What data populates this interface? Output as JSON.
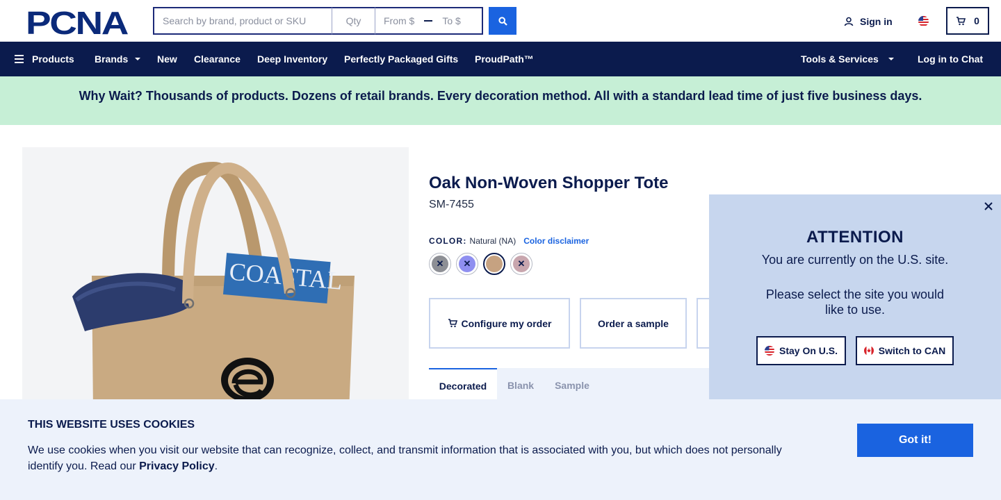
{
  "header": {
    "logo_text": "PCNA",
    "search": {
      "placeholder": "Search by brand, product or SKU"
    },
    "qty": {
      "placeholder": "Qty"
    },
    "price": {
      "from_placeholder": "From $",
      "to_placeholder": "To $"
    },
    "sign_in_label": "Sign in",
    "cart_count": "0"
  },
  "nav": {
    "items": [
      "Products",
      "Brands",
      "New",
      "Clearance",
      "Deep Inventory",
      "Perfectly Packaged Gifts",
      "ProudPath™"
    ],
    "tools_label": "Tools & Services",
    "chat_label": "Log in to Chat"
  },
  "promo": {
    "text": "Why Wait? Thousands of products. Dozens of retail brands. Every decoration method. All with a standard lead time of just five business days."
  },
  "product": {
    "title": "Oak Non-Woven Shopper Tote",
    "sku": "SM-7455",
    "color_label": "COLOR:",
    "color_value": "Natural (NA)",
    "color_disclaimer": "Color disclaimer",
    "swatch_colors": [
      "#8d8f95",
      "#8f8ff0",
      "#c6a281",
      "#c8a6ae"
    ],
    "actions": {
      "configure": "Configure my order",
      "sample": "Order a sample"
    },
    "tabs": [
      "Decorated",
      "Blank",
      "Sample"
    ],
    "image_text": "COASTAL"
  },
  "region_popup": {
    "title": "ATTENTION",
    "message": "You are currently on the U.S. site.",
    "prompt": "Please select the site you would like to use.",
    "stay_label": "Stay On U.S.",
    "switch_label": "Switch to CAN"
  },
  "cookie": {
    "title": "THIS WEBSITE USES COOKIES",
    "text": "We use cookies when you visit our website that can recognize, collect, and transmit information that is associated with you, but which does not personally identify you. Read our ",
    "link": "Privacy Policy",
    "end": ".",
    "button": "Got it!"
  },
  "colors": {
    "navy": "#0b1b4d",
    "blue": "#1a63e0",
    "promo_bg": "#c6efd6",
    "popup_bg": "#c7d6ee",
    "cookie_bg": "#edf2fb"
  }
}
